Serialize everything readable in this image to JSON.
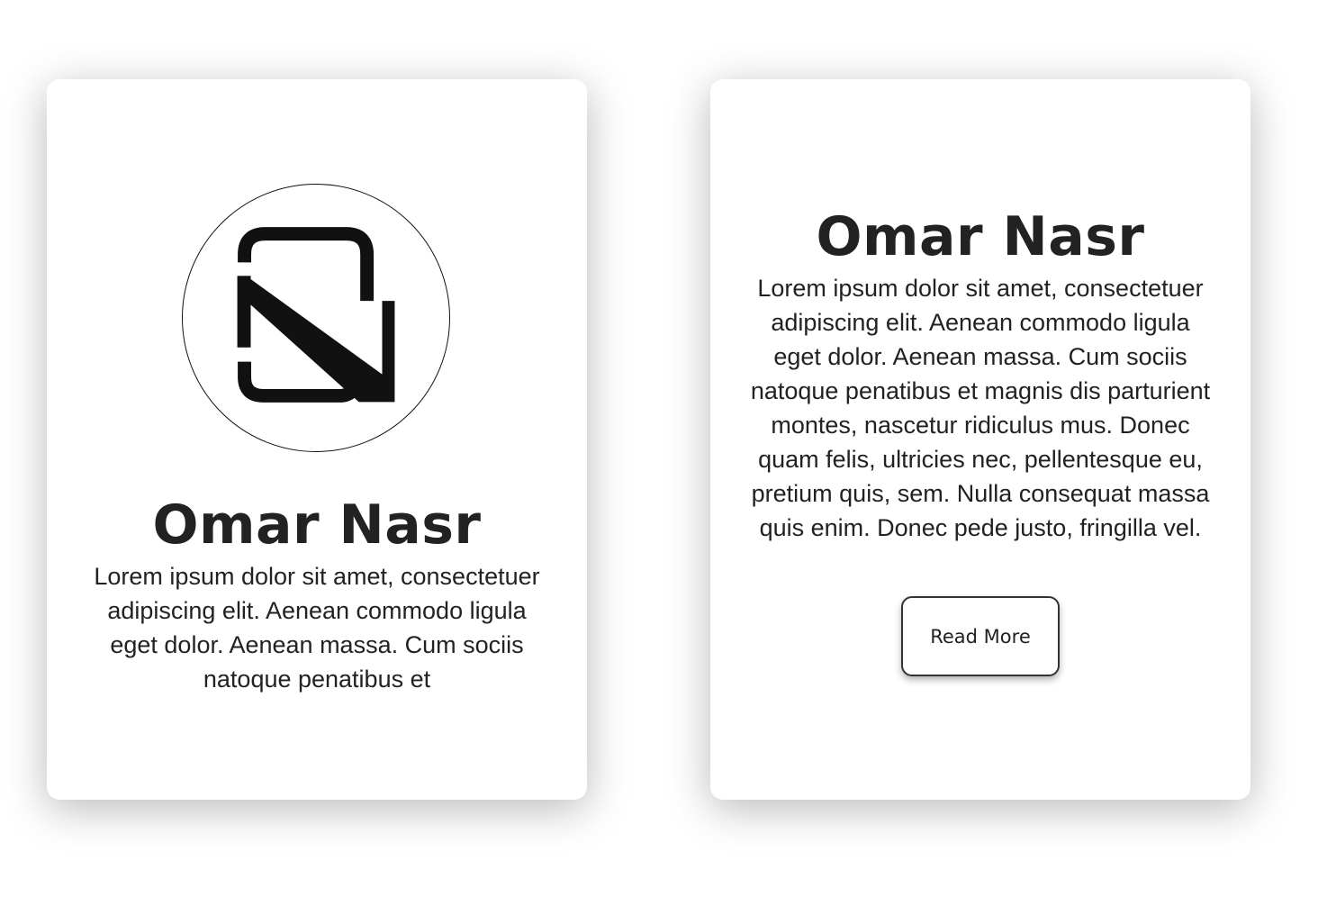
{
  "front_card": {
    "logo_icon": "omar-nasr-monogram-icon",
    "name": "Omar Nasr",
    "bio": "Lorem ipsum dolor sit amet, consectetuer adipiscing elit. Aenean commodo ligula eget dolor. Aenean massa. Cum sociis natoque penatibus et"
  },
  "back_card": {
    "name": "Omar Nasr",
    "bio": "Lorem ipsum dolor sit amet, consectetuer adipiscing elit. Aenean commodo ligula eget dolor. Aenean massa. Cum sociis natoque penatibus et magnis dis parturient montes, nascetur ridiculus mus. Donec quam felis, ultricies nec, pellentesque eu, pretium quis, sem. Nulla consequat massa quis enim. Donec pede justo, fringilla vel.",
    "button_label": "Read More"
  },
  "colors": {
    "page_background": "#ffffff",
    "card_background": "#ffffff",
    "text": "#222222",
    "logo": "#111111"
  }
}
